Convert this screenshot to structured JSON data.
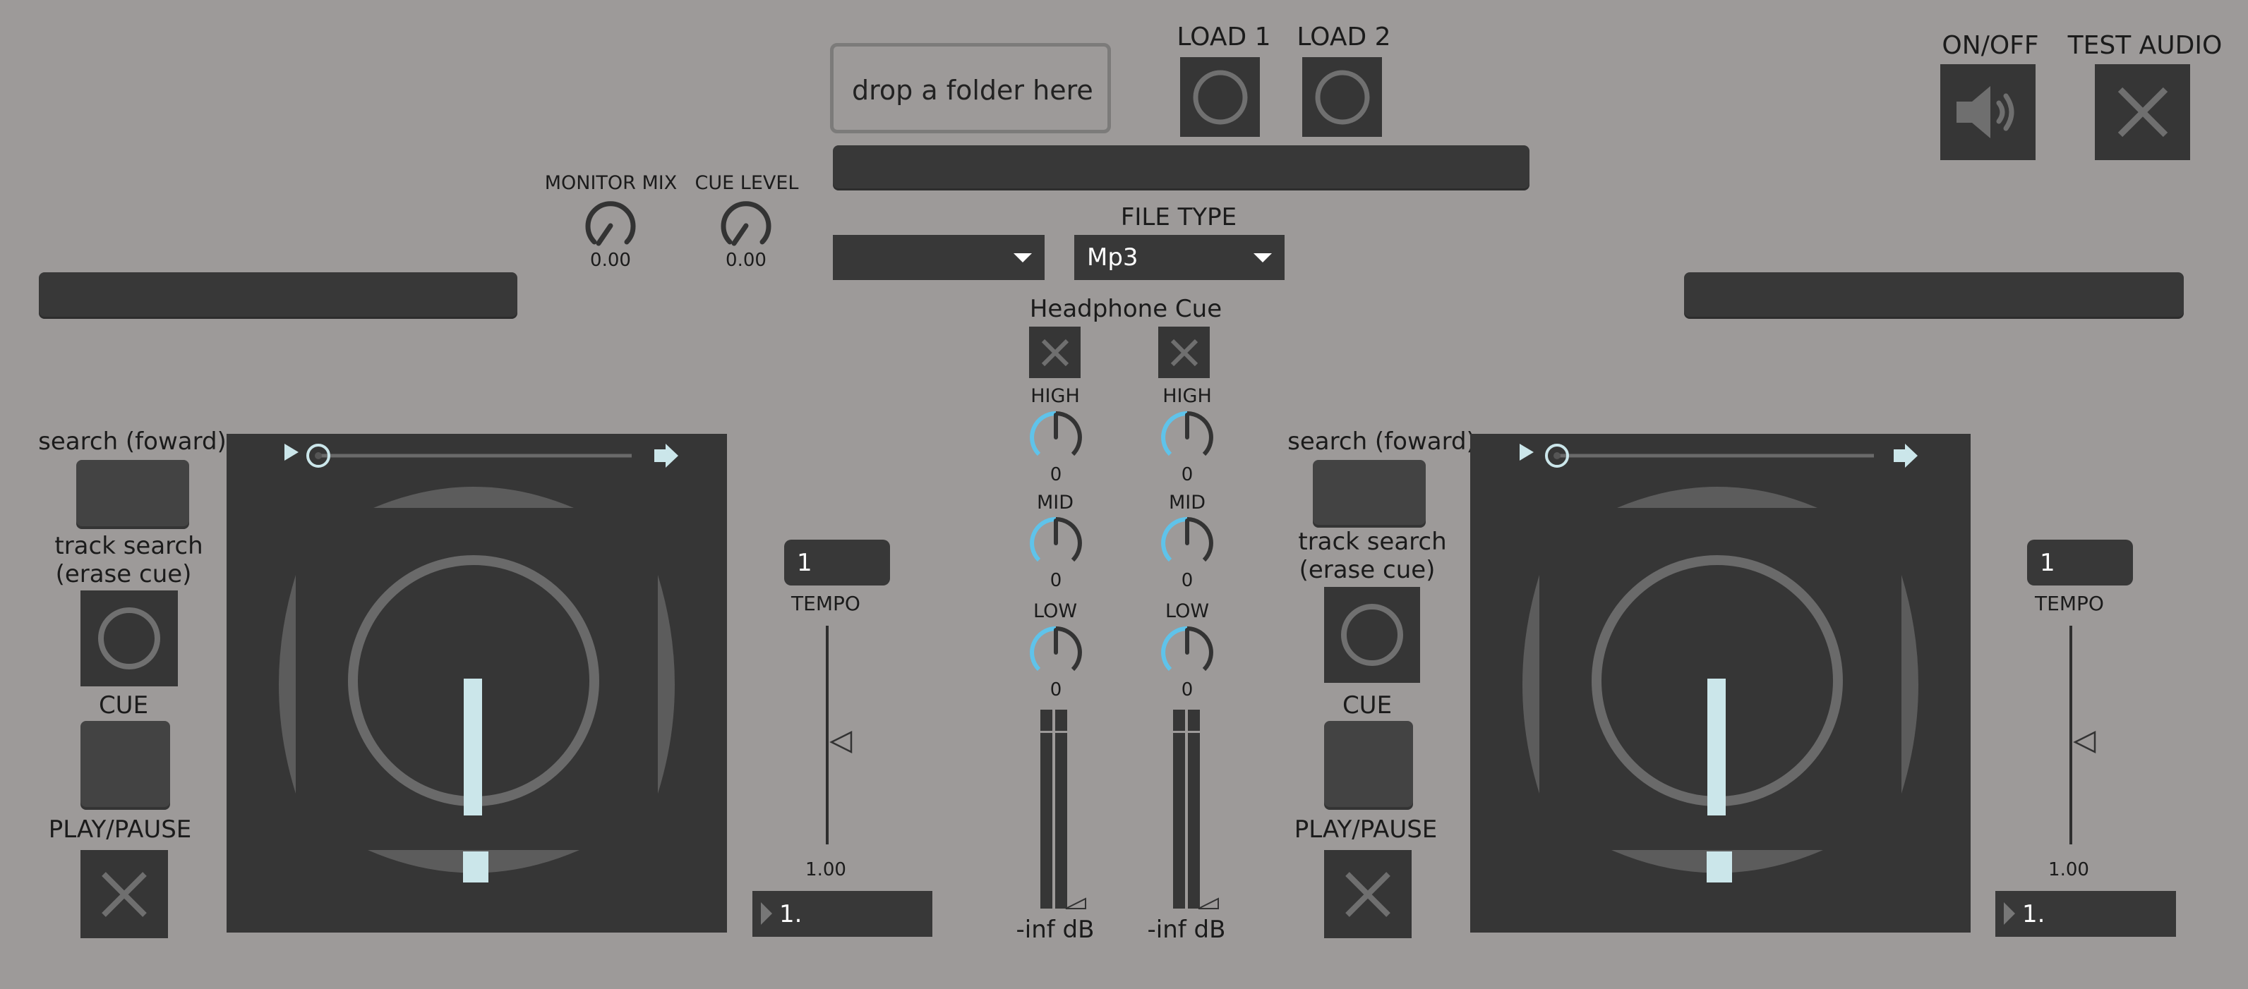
{
  "header": {
    "drop_zone": "drop a folder here",
    "load1": "LOAD 1",
    "load2": "LOAD 2",
    "onoff": "ON/OFF",
    "test_audio": "TEST AUDIO"
  },
  "mixer": {
    "monitor_mix_label": "MONITOR MIX",
    "monitor_mix_value": "0.00",
    "cue_level_label": "CUE LEVEL",
    "cue_level_value": "0.00",
    "file_type_label": "FILE TYPE",
    "file_type_value": "Mp3",
    "headphone_cue_label": "Headphone Cue",
    "channels": [
      {
        "high_label": "HIGH",
        "high_value": "0",
        "mid_label": "MID",
        "mid_value": "0",
        "low_label": "LOW",
        "low_value": "0",
        "meter_label": "-inf dB"
      },
      {
        "high_label": "HIGH",
        "high_value": "0",
        "mid_label": "MID",
        "mid_value": "0",
        "low_label": "LOW",
        "low_value": "0",
        "meter_label": "-inf dB"
      }
    ]
  },
  "decks": [
    {
      "search_label": "search (foward)",
      "track_search_line1": "track search",
      "track_search_line2": "(erase cue)",
      "cue_label": "CUE",
      "play_label": "PLAY/PAUSE",
      "tempo_box": "1",
      "tempo_label": "TEMPO",
      "tempo_value": "1.00",
      "bottom_box": "1."
    },
    {
      "search_label": "search (foward)",
      "track_search_line1": "track search",
      "track_search_line2": "(erase cue)",
      "cue_label": "CUE",
      "play_label": "PLAY/PAUSE",
      "tempo_box": "1",
      "tempo_label": "TEMPO",
      "tempo_value": "1.00",
      "bottom_box": "1."
    }
  ],
  "colors": {
    "background": "#9d9a99",
    "panel": "#363636",
    "accent_blue": "#5fc3ea",
    "light_cyan": "#cbe6ea"
  },
  "icons": {
    "load_buttons": "circle-icon",
    "onoff": "speaker-icon",
    "test_audio": "x-icon",
    "headphone_cue": "x-icon",
    "play_pause": "x-icon",
    "track_search": "circle-icon"
  }
}
